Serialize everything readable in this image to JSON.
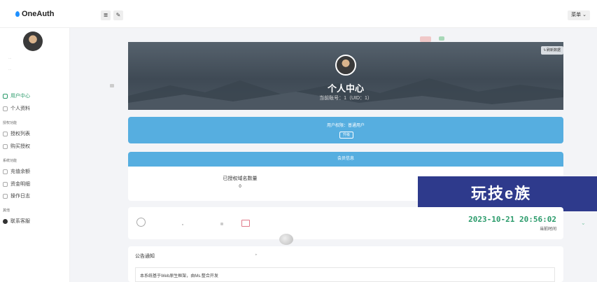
{
  "app": {
    "name": "OneAuth"
  },
  "header": {
    "menu_label": "菜单",
    "list_icon": "≣",
    "brush_icon": "✎"
  },
  "sidebar": {
    "faint_lines": [
      "...",
      "..."
    ],
    "sections": [
      {
        "label": "",
        "items": [
          {
            "label": "用户中心",
            "icon": "home-icon",
            "active": true
          },
          {
            "label": "个人资料",
            "icon": "user-icon",
            "active": false
          }
        ]
      },
      {
        "label": "授权功能",
        "items": [
          {
            "label": "授权列表",
            "icon": "list-icon",
            "active": false
          },
          {
            "label": "购买授权",
            "icon": "cart-icon",
            "active": false
          }
        ]
      },
      {
        "label": "系统功能",
        "items": [
          {
            "label": "充值余额",
            "icon": "wallet-icon",
            "active": false
          },
          {
            "label": "资金明细",
            "icon": "ledger-icon",
            "active": false
          },
          {
            "label": "操作日志",
            "icon": "log-icon",
            "active": false
          }
        ]
      },
      {
        "label": "其他",
        "items": [
          {
            "label": "联系客服",
            "icon": "support-icon",
            "active": false
          }
        ]
      }
    ]
  },
  "profile": {
    "sync_label": "刷新数据",
    "title": "个人中心",
    "uid_line": "当前账号：1（UID：1）"
  },
  "permission": {
    "line": "用户权限：普通用户",
    "upgrade_label": "升级"
  },
  "member": {
    "header": "会员信息",
    "auth_count_label": "已授权域名数量",
    "auth_count_value": "0"
  },
  "watermark": {
    "text": "玩技e族"
  },
  "clock_panel": {
    "time": "2023-10-21 20:56:02",
    "label": "当前时间"
  },
  "notice": {
    "title": "公告通知",
    "body": "本系统基于Web原生框架，由Ms.整合开发"
  },
  "colors": {
    "accent_blue": "#56aee0",
    "accent_green": "#2b9b6b",
    "watermark_bg": "#2e3a8c"
  }
}
